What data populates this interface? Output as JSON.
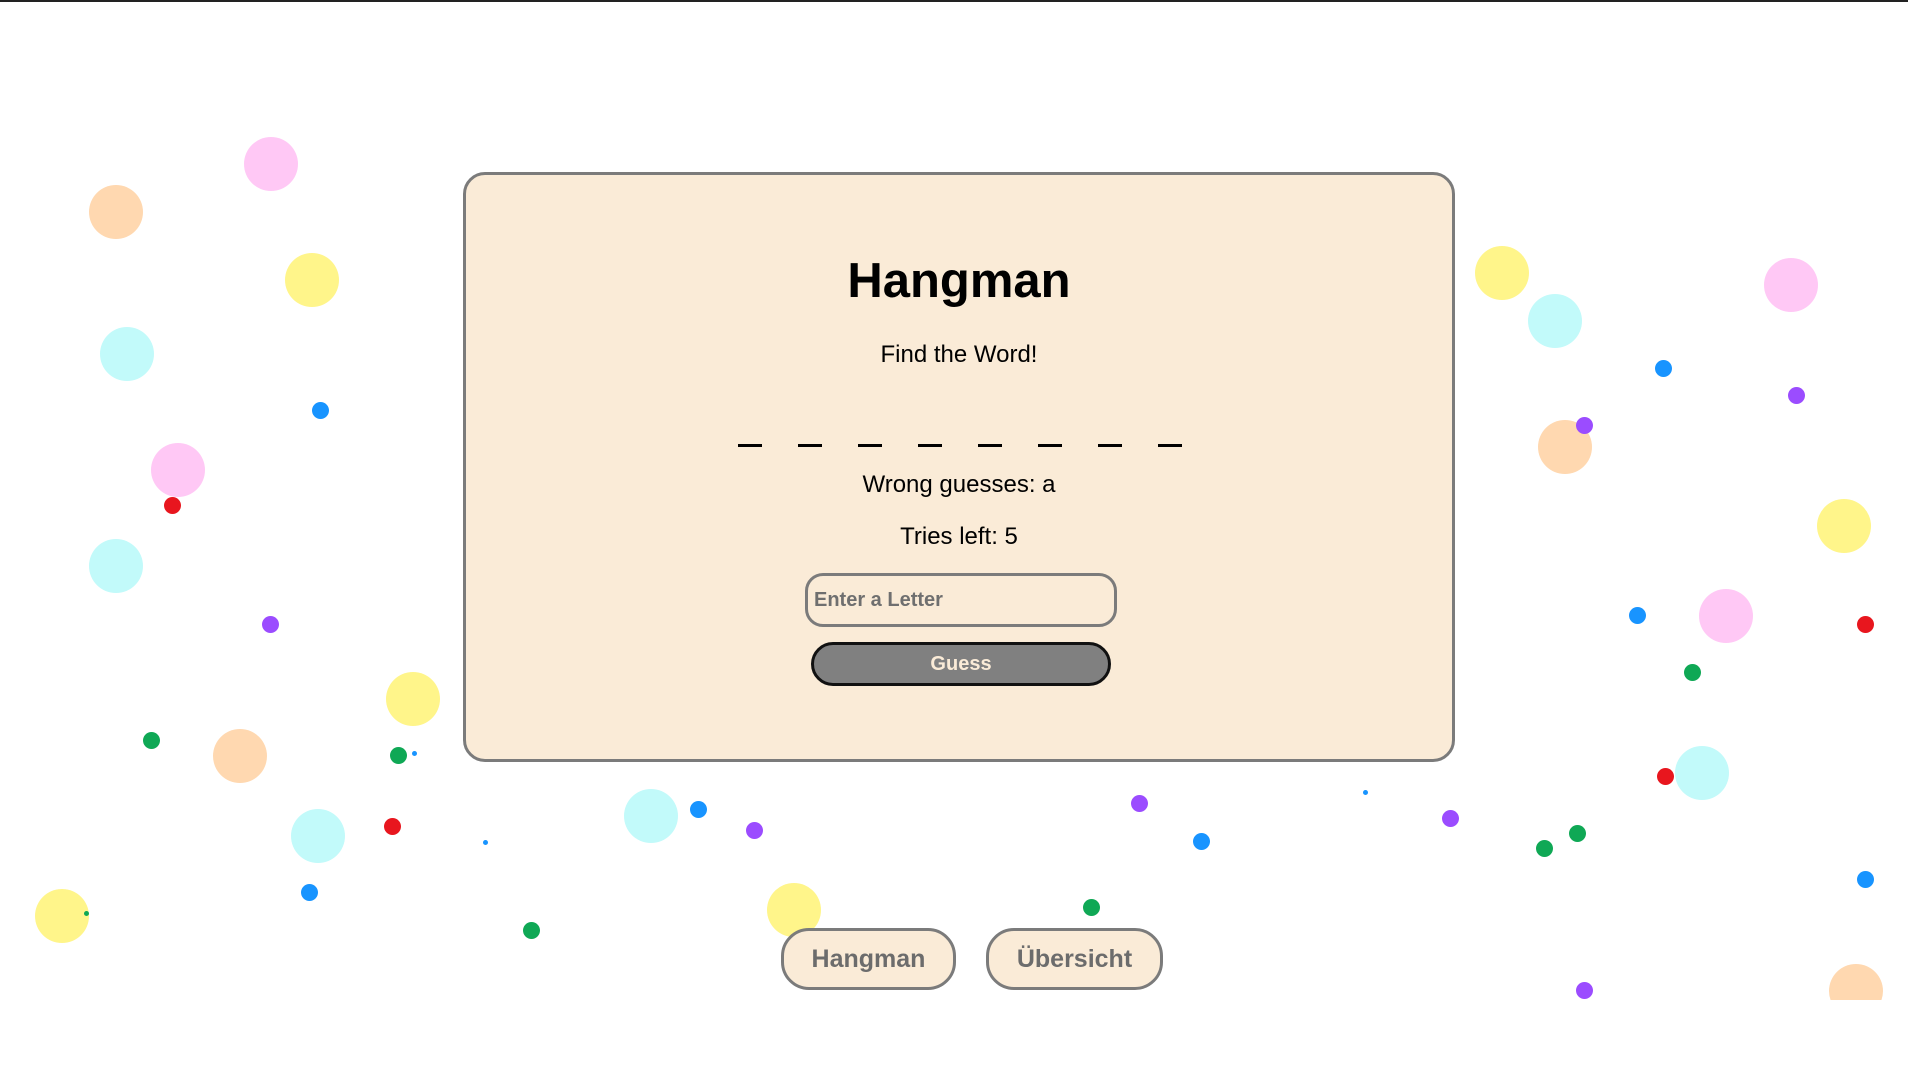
{
  "colors": {
    "card_background": "#faebd7",
    "card_border": "#7b7b7b",
    "guess_button_background": "#808080",
    "guess_button_text": "#faebd7",
    "nav_text": "#6c6c6c",
    "confetti": [
      "#ffc8f5",
      "#ffd8b0",
      "#fff58a",
      "#c2fafa",
      "#1894ff",
      "#9b4cff",
      "#e8161e",
      "#0fa855"
    ]
  },
  "game": {
    "title": "Hangman",
    "subtitle": "Find the Word!",
    "word_length": 8,
    "wrong_guesses": "Wrong guesses: a",
    "tries_left": "Tries left: 5",
    "input": {
      "placeholder": "Enter a Letter",
      "value": ""
    },
    "guess_label": "Guess"
  },
  "nav": {
    "hangman_label": "Hangman",
    "overview_label": "Übersicht"
  }
}
